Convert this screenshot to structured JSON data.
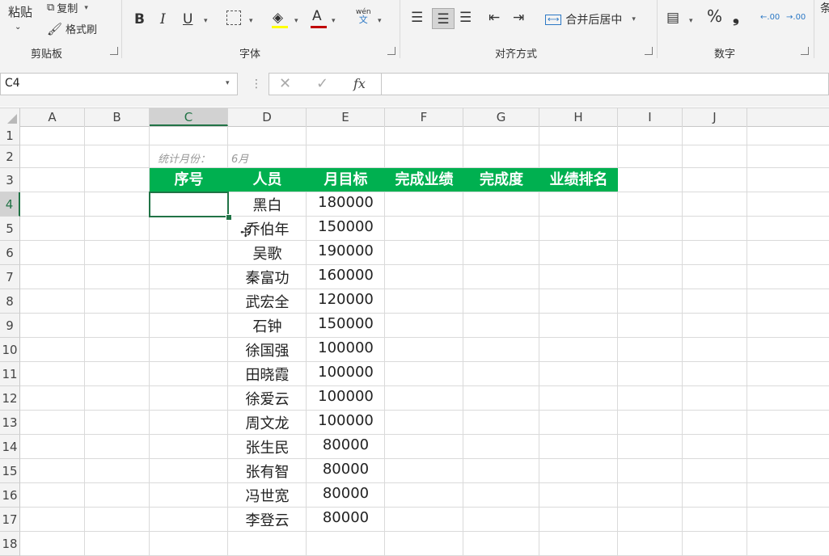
{
  "ribbon": {
    "clipboard": {
      "paste": "粘贴",
      "copy": "复制",
      "format_painter": "格式刷",
      "group": "剪贴板"
    },
    "font": {
      "group": "字体",
      "bold": "B",
      "italic": "I",
      "underline": "U",
      "font_color": "A",
      "wen": "wén",
      "wen_char": "文"
    },
    "alignment": {
      "merge_center": "合并后居中",
      "group": "对齐方式"
    },
    "number": {
      "percent": "%",
      "comma": "❟",
      "inc_dec": ".00",
      "dec_dec": ".00",
      "group": "数字"
    },
    "cut_off": "条"
  },
  "formula_bar": {
    "name_box": "C4",
    "formula": "",
    "fx": "fx",
    "cancel": "✕",
    "enter": "✓"
  },
  "columns": [
    "A",
    "B",
    "C",
    "D",
    "E",
    "F",
    "G",
    "H",
    "I",
    "J"
  ],
  "rows": [
    "1",
    "2",
    "3",
    "4",
    "5",
    "6",
    "7",
    "8",
    "9",
    "10",
    "11",
    "12",
    "13",
    "14",
    "15",
    "16",
    "17",
    "18"
  ],
  "sheet": {
    "month_label": "统计月份：",
    "month_value": "6月",
    "headers": [
      "序号",
      "人员",
      "月目标",
      "完成业绩",
      "完成度",
      "业绩排名"
    ],
    "data": [
      {
        "name": "黑白",
        "target": "180000"
      },
      {
        "name": "乔伯年",
        "target": "150000"
      },
      {
        "name": "吴歌",
        "target": "190000"
      },
      {
        "name": "秦富功",
        "target": "160000"
      },
      {
        "name": "武宏全",
        "target": "120000"
      },
      {
        "name": "石钟",
        "target": "150000"
      },
      {
        "name": "徐国强",
        "target": "100000"
      },
      {
        "name": "田晓霞",
        "target": "100000"
      },
      {
        "name": "徐爱云",
        "target": "100000"
      },
      {
        "name": "周文龙",
        "target": "100000"
      },
      {
        "name": "张生民",
        "target": "80000"
      },
      {
        "name": "张有智",
        "target": "80000"
      },
      {
        "name": "冯世宽",
        "target": "80000"
      },
      {
        "name": "李登云",
        "target": "80000"
      }
    ]
  },
  "colors": {
    "header_fill": "#00b050",
    "selection": "#217346"
  }
}
